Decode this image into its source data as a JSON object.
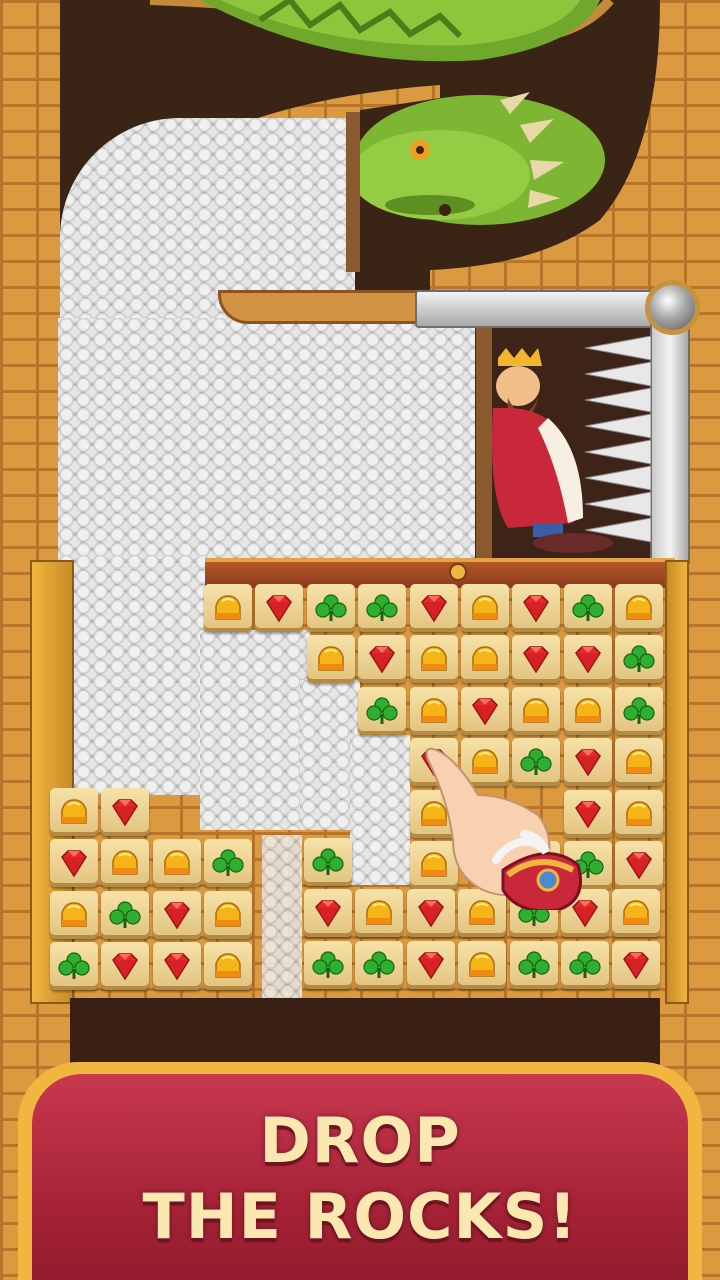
{
  "banner": {
    "line1": "DROP",
    "line2": "THE ROCKS!"
  },
  "colors": {
    "banner_fill": "#a52236",
    "banner_border": "#f0b640",
    "headline_text": "#fbe7b0",
    "wall_brick": "#dc9a40"
  },
  "characters": {
    "dragon": "dragon",
    "king": "king"
  },
  "icons": {
    "pin": "metal-pin-icon",
    "spikes": "spikes-icon",
    "hand": "pointing-hand-icon"
  },
  "board": {
    "rows": [
      [
        "crown",
        "ruby",
        "clover",
        "clover",
        "ruby",
        "crown",
        "ruby",
        "clover",
        "crown"
      ],
      [
        "",
        "",
        "crown",
        "ruby",
        "crown",
        "crown",
        "ruby",
        "ruby",
        "clover"
      ],
      [
        "",
        "",
        "",
        "clover",
        "crown",
        "ruby",
        "crown",
        "crown",
        "clover"
      ],
      [
        "",
        "",
        "",
        "",
        "ruby",
        "crown",
        "clover",
        "ruby",
        "crown"
      ],
      [
        "",
        "",
        "",
        "",
        "crown",
        "",
        "",
        "ruby",
        "crown"
      ],
      [
        "",
        "",
        "",
        "",
        "crown",
        "",
        "clover",
        "clover",
        "ruby"
      ],
      [
        "",
        "",
        "",
        "",
        "",
        "",
        "",
        "",
        ""
      ],
      [
        "",
        "",
        "",
        "",
        "",
        "",
        "",
        "",
        ""
      ]
    ],
    "left_block": [
      [
        "crown",
        "ruby",
        "",
        ""
      ],
      [
        "ruby",
        "crown",
        "crown",
        "clover"
      ],
      [
        "crown",
        "clover",
        "ruby",
        "crown"
      ],
      [
        "clover",
        "ruby",
        "ruby",
        "crown"
      ]
    ],
    "right_block": [
      [
        "clover",
        "",
        "",
        "",
        "",
        "",
        ""
      ],
      [
        "ruby",
        "crown",
        "ruby",
        "crown",
        "clover",
        "ruby",
        "crown"
      ],
      [
        "clover",
        "clover",
        "ruby",
        "crown",
        "clover",
        "clover",
        "ruby"
      ]
    ]
  }
}
